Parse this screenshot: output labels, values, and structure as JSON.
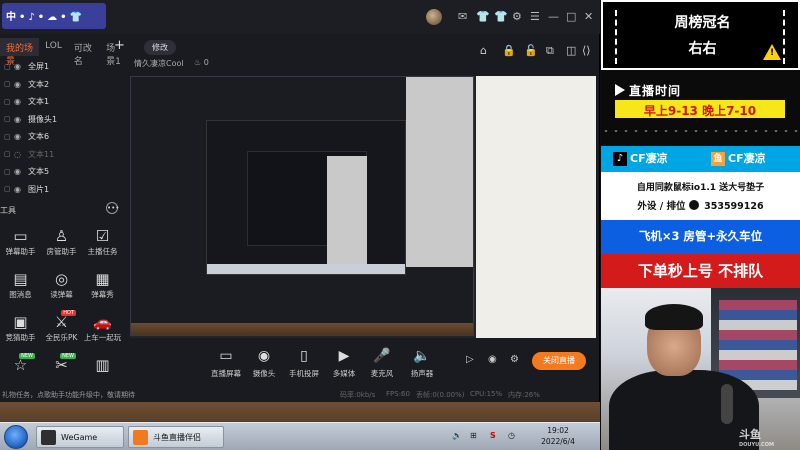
{
  "app": {
    "logo_text": "中•♪•☁•👕",
    "window_controls": [
      "✉",
      "👕",
      "👕",
      "⚙",
      "☰",
      "—",
      "□",
      "✕"
    ]
  },
  "scenes": {
    "tabs": [
      "我的场景",
      "LOL",
      "可改名",
      "场景1"
    ],
    "add": "+"
  },
  "layers": [
    {
      "name": "全屏1",
      "enabled": true,
      "eye": "◉"
    },
    {
      "name": "文本2",
      "enabled": true,
      "eye": "◉"
    },
    {
      "name": "文本1",
      "enabled": true,
      "eye": "◉"
    },
    {
      "name": "摄像头1",
      "enabled": true,
      "eye": "◉"
    },
    {
      "name": "文本6",
      "enabled": true,
      "eye": "◉"
    },
    {
      "name": "文本11",
      "enabled": false,
      "eye": "◌"
    },
    {
      "name": "文本5",
      "enabled": true,
      "eye": "◉"
    },
    {
      "name": "图片1",
      "enabled": true,
      "eye": "◉"
    }
  ],
  "tools": {
    "title": "工具",
    "items": [
      {
        "label": "弹幕助手",
        "icon": "▭",
        "badge": ""
      },
      {
        "label": "房管助手",
        "icon": "♙",
        "badge": ""
      },
      {
        "label": "主播任务",
        "icon": "☑",
        "badge": ""
      },
      {
        "label": "图消息",
        "icon": "▤",
        "badge": ""
      },
      {
        "label": "读弹幕",
        "icon": "◎",
        "badge": ""
      },
      {
        "label": "弹幕秀",
        "icon": "▦",
        "badge": ""
      },
      {
        "label": "竞猜助手",
        "icon": "▣",
        "badge": ""
      },
      {
        "label": "全民乐PK",
        "icon": "⚔",
        "badge": "HOT"
      },
      {
        "label": "上车一起玩",
        "icon": "🚗",
        "badge": ""
      },
      {
        "label": "",
        "icon": "☆",
        "badge": "NEW"
      },
      {
        "label": "",
        "icon": "✂",
        "badge": "NEW"
      },
      {
        "label": "",
        "icon": "▥",
        "badge": ""
      }
    ]
  },
  "preview_head": {
    "mode_tab": "修改",
    "room_name": "情久凄凉Cool",
    "heat": "0",
    "icons": [
      "⌂",
      "🔒",
      "🔓",
      "⧉",
      "◫",
      "⟨⟩"
    ]
  },
  "bottom_bar": {
    "buttons": [
      {
        "label": "直播屏幕",
        "icon": "▭"
      },
      {
        "label": "摄像头",
        "icon": "◉"
      },
      {
        "label": "手机投屏",
        "icon": "▯"
      },
      {
        "label": "多媒体",
        "icon": "▶"
      },
      {
        "label": "麦克风",
        "icon": "🎤"
      },
      {
        "label": "扬声器",
        "icon": "🔈"
      }
    ],
    "close_label": "关闭直播",
    "small_icons": [
      "▷",
      "◉",
      "⚙"
    ]
  },
  "status_bar": {
    "tip": "礼物任务，点歌助手功能升级中，敬请期待",
    "stats": [
      "码率:0kb/s",
      "FPS:60",
      "丢帧:0(0.00%)",
      "CPU:15%",
      "内存:26%"
    ]
  },
  "taskbar": {
    "apps": [
      {
        "label": "WeGame",
        "color": "#2f2f2f"
      },
      {
        "label": "斗鱼直播伴侣",
        "color": "#f07a1d"
      }
    ],
    "tray": [
      "🔊",
      "⊞",
      "S",
      "◷"
    ],
    "time": "19:02",
    "date": "2022/6/4"
  },
  "overlay": {
    "rank_title": "周榜冠名",
    "rank_name": "右右",
    "warn_mark": "!",
    "time_title": "直播时间",
    "time_text": "早上9-13 晚上7-10",
    "cf_left": "CF凄凉",
    "cf_right": "CF凄凉",
    "tiktok_glyph": "♪",
    "douyu_glyph": "鱼",
    "info_line1": "自用同款鼠标io1.1  送大号垫子",
    "info_line2": "外设 / 排位",
    "qq_number": "353599126",
    "perks": "飞机×3  房管+永久车位",
    "fast": "下单秒上号 不排队",
    "watermark": "斗鱼",
    "watermark_sub": "DOUYU.COM"
  },
  "colors": {
    "accent": "#f37a1f",
    "overlay_blue": "#00a5e3",
    "perks_blue": "#0b5fe0",
    "fast_red": "#d41b1b",
    "time_yellow": "#f6e61a"
  }
}
